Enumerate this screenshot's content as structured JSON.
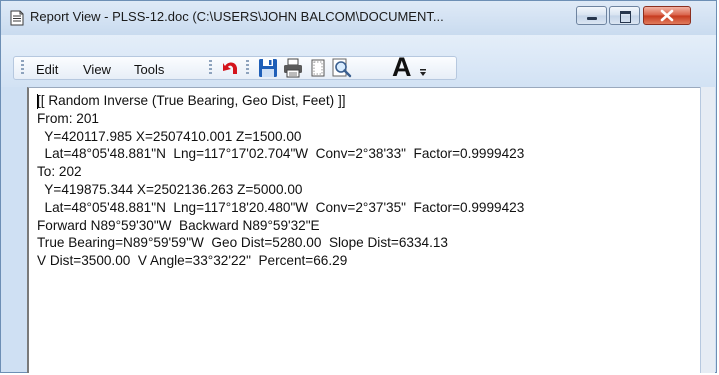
{
  "window": {
    "title": "Report View - PLSS-12.doc (C:\\USERS\\JOHN BALCOM\\DOCUMENT..."
  },
  "caption_buttons": [
    "minimize",
    "maximize",
    "close"
  ],
  "menu": {
    "items": [
      "Edit",
      "View",
      "Tools"
    ]
  },
  "toolbar": {
    "buttons": [
      "undo",
      "save",
      "print",
      "page-setup",
      "find",
      "font"
    ],
    "font_label": "A"
  },
  "report": {
    "lines": [
      "[[ Random Inverse (True Bearing, Geo Dist, Feet) ]]",
      "From: 201",
      "  Y=420117.985 X=2507410.001 Z=1500.00",
      "  Lat=48°05'48.881\"N  Lng=117°17'02.704\"W  Conv=2°38'33\"  Factor=0.9999423",
      "To: 202",
      "  Y=419875.344 X=2502136.263 Z=5000.00",
      "  Lat=48°05'48.881\"N  Lng=117°18'20.480\"W  Conv=2°37'35\"  Factor=0.9999423",
      "Forward N89°59'30\"W  Backward N89°59'32\"E",
      "True Bearing=N89°59'59\"W  Geo Dist=5280.00  Slope Dist=6334.13",
      "V Dist=3500.00  V Angle=33°32'22\"  Percent=66.29"
    ]
  },
  "colors": {
    "undo_red": "#d4141c",
    "save_blue": "#1f5fb8",
    "close_red": "#c63a1e"
  }
}
